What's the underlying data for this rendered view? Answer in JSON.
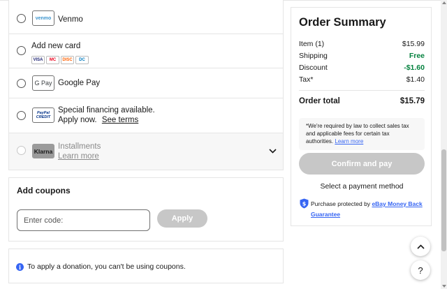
{
  "payment": {
    "venmo": {
      "logo": "venmo",
      "label": "Venmo"
    },
    "card": {
      "label": "Add new card",
      "networks": [
        "VISA",
        "MC",
        "DISC",
        "DC"
      ]
    },
    "gpay": {
      "logo": "G Pay",
      "label": "Google Pay"
    },
    "paypal_credit": {
      "logo_line1": "PayPal",
      "logo_line2": "CREDIT",
      "line1": "Special financing available.",
      "line2_prefix": "Apply now.",
      "line2_link": "See terms"
    },
    "klarna": {
      "logo": "Klarna",
      "label": "Installments",
      "link": "Learn more"
    }
  },
  "coupons": {
    "title": "Add coupons",
    "input_placeholder": "Enter code:",
    "apply_label": "Apply"
  },
  "donation": {
    "text": "To apply a donation, you can't be using coupons."
  },
  "summary": {
    "title": "Order Summary",
    "rows": [
      {
        "label": "Item (1)",
        "value": "$15.99"
      },
      {
        "label": "Shipping",
        "value": "Free"
      },
      {
        "label": "Discount",
        "value": "-$1.60"
      },
      {
        "label": "Tax*",
        "value": "$1.40"
      }
    ],
    "total_label": "Order total",
    "total_value": "$15.79",
    "tax_note": "*We're required by law to collect sales tax and applicable fees for certain tax authorities.",
    "tax_link": "Learn more",
    "confirm_label": "Confirm and pay",
    "select_msg": "Select a payment method",
    "protect_prefix": "Purchase protected by",
    "protect_link": "eBay Money Back Guarantee"
  },
  "fabs": {
    "help": "?"
  },
  "colors": {
    "accent": "#3665f3",
    "positive": "#05823f",
    "disabled": "#c7c7c7"
  }
}
